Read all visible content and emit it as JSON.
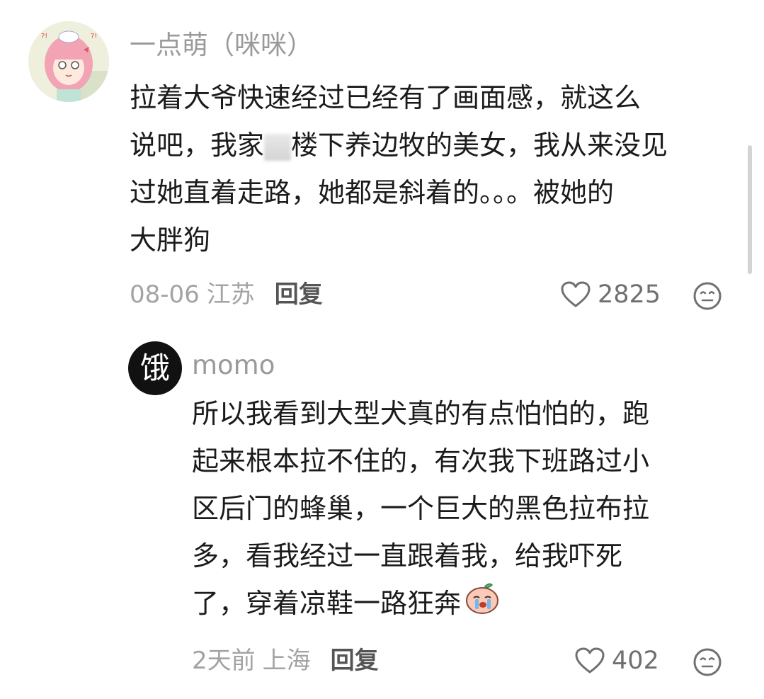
{
  "comments": [
    {
      "username": "一点萌（咪咪）",
      "lines": [
        "拉着大爷快速经过已经有了画面感，就这么",
        "说吧，我家",
        "楼下养边牧的美女，我从来没见",
        "过她直着走路，她都是斜着的。。。被她的",
        "大胖狗"
      ],
      "date": "08-06",
      "location": "江苏",
      "reply_label": "回复",
      "likes": "2825",
      "avatar_icon": "anime-girl-avatar"
    },
    {
      "username": "momo",
      "avatar_text": "饿",
      "lines": [
        "所以我看到大型犬真的有点怕怕的，跑",
        "起来根本拉不住的，有次我下班路过小",
        "区后门的蜂巢，一个巨大的黑色拉布拉",
        "多，看我经过一直跟着我，给我吓死",
        "了，穿着凉鞋一路狂奔"
      ],
      "date": "2天前",
      "location": "上海",
      "reply_label": "回复",
      "likes": "402",
      "inline_emoji": "crying-peach-emoji"
    }
  ],
  "colors": {
    "text": "#1b1b1b",
    "meta": "#a3a3a3",
    "reply": "#555555",
    "likes": "#707070"
  }
}
